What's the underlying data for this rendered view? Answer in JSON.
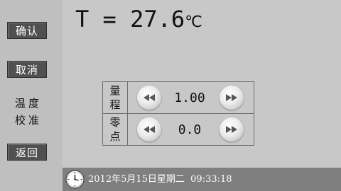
{
  "sidebar": {
    "confirm_label": "确认",
    "cancel_label": "取消",
    "title_line1": "温度",
    "title_line2": "校准",
    "back_label": "返回"
  },
  "display": {
    "temperature": "T = 27.6",
    "unit": "℃"
  },
  "calibration": {
    "range": {
      "label_line1": "量",
      "label_line2": "程",
      "value": "1.00"
    },
    "zero": {
      "label_line1": "零",
      "label_line2": "点",
      "value": "0.0"
    }
  },
  "icons": {
    "decrease": "rewind-icon",
    "increase": "fast-forward-icon",
    "clock": "clock-icon"
  },
  "status": {
    "datetime": "2012年5月15日星期二  09:33:18"
  }
}
